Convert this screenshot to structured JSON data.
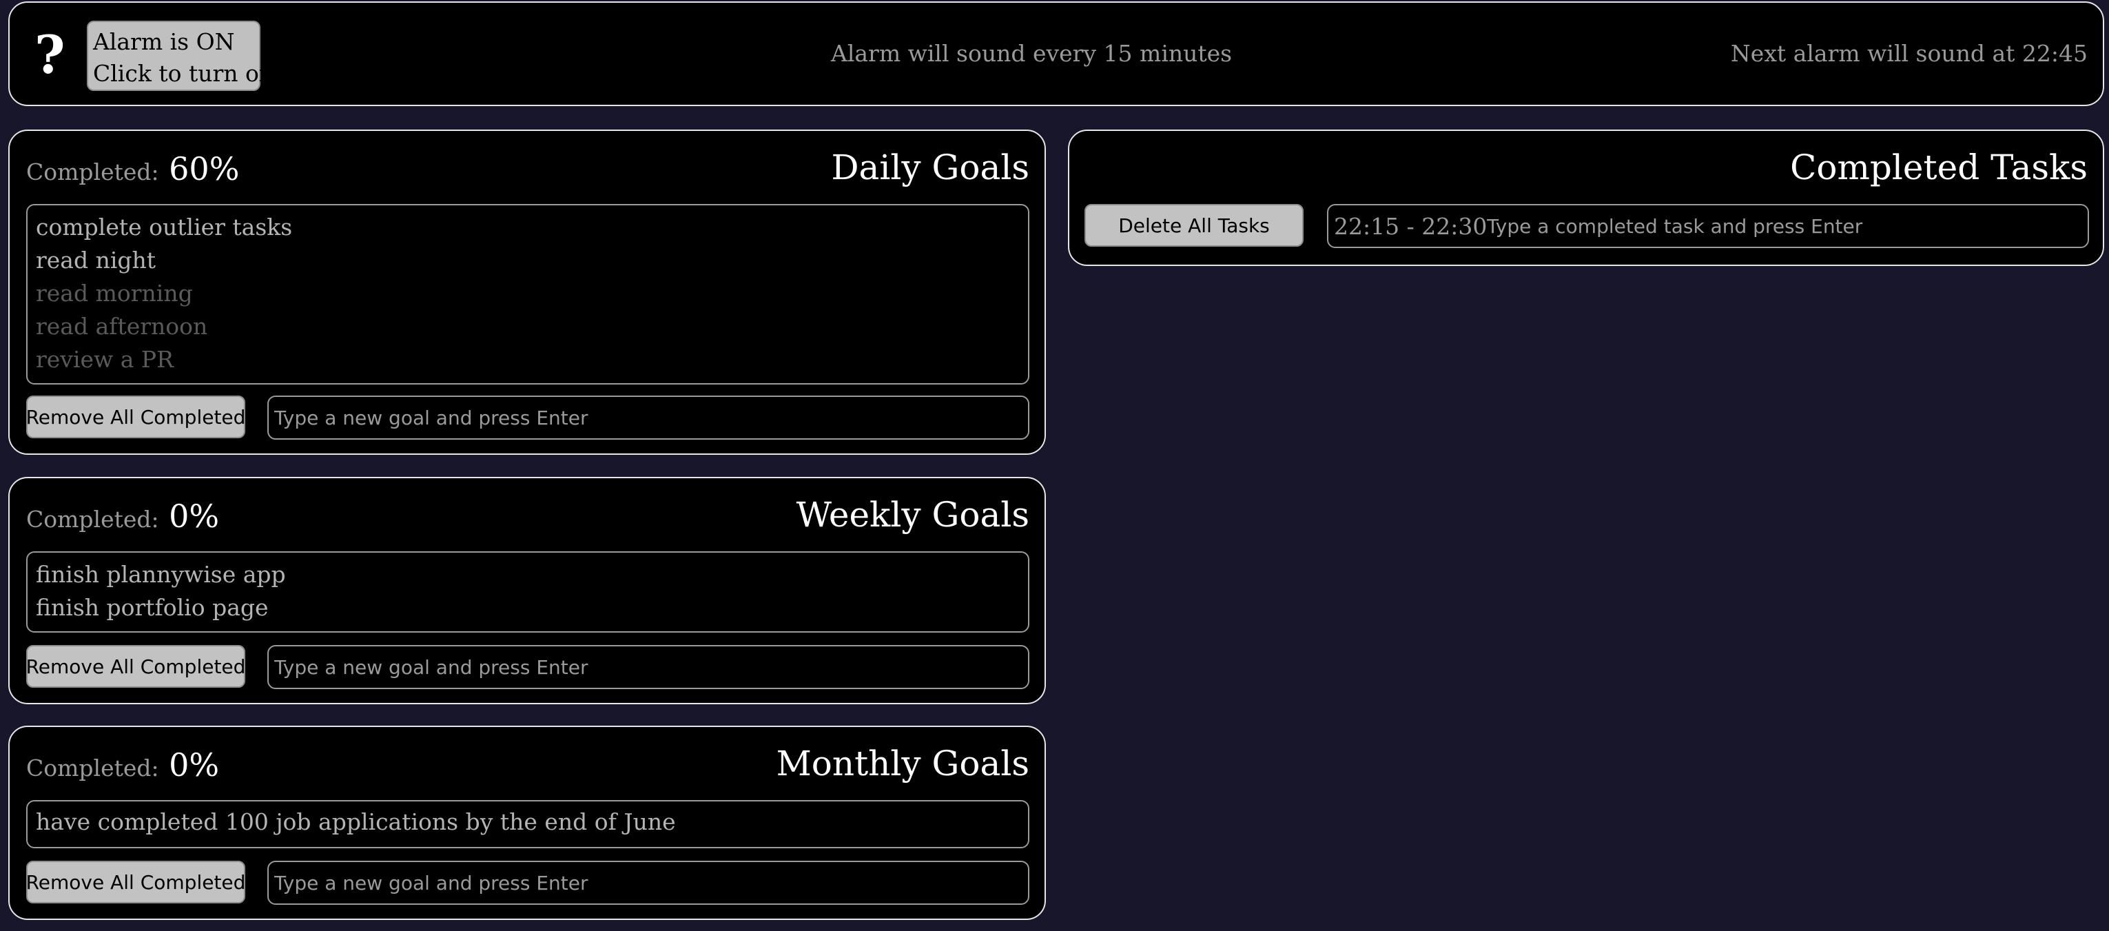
{
  "header": {
    "help_icon": "?",
    "alarm_toggle": {
      "status": "Alarm is ON",
      "action": "Click to turn off"
    },
    "alarm_interval_text": "Alarm will sound every 15 minutes",
    "next_alarm_text": "Next alarm will sound at 22:45"
  },
  "colors": {
    "page_background": "#17162a",
    "panel_background": "#000000",
    "panel_border": "#e6e6e6",
    "button_background": "#c2c2c2",
    "active_goal_text": "#b4b4b4",
    "completed_goal_text": "#5a5a5a"
  },
  "daily": {
    "completed_label": "Completed:",
    "completed_pct": "60%",
    "title": "Daily Goals",
    "goals": [
      {
        "text": "complete outlier tasks",
        "done": false
      },
      {
        "text": "read night",
        "done": false
      },
      {
        "text": "read morning",
        "done": true
      },
      {
        "text": "read afternoon",
        "done": true
      },
      {
        "text": "review a PR",
        "done": true
      }
    ],
    "remove_button": "Remove All Completed",
    "input_placeholder": "Type a new goal and press Enter"
  },
  "weekly": {
    "completed_label": "Completed:",
    "completed_pct": "0%",
    "title": "Weekly Goals",
    "goals": [
      {
        "text": "finish plannywise app",
        "done": false
      },
      {
        "text": "finish portfolio page",
        "done": false
      }
    ],
    "remove_button": "Remove All Completed",
    "input_placeholder": "Type a new goal and press Enter"
  },
  "monthly": {
    "completed_label": "Completed:",
    "completed_pct": "0%",
    "title": "Monthly Goals",
    "goals": [
      {
        "text": "have completed 100 job applications by the end of June",
        "done": false
      }
    ],
    "remove_button": "Remove All Completed",
    "input_placeholder": "Type a new goal and press Enter"
  },
  "completed_tasks": {
    "title": "Completed Tasks",
    "delete_button": "Delete All Tasks",
    "time_range": "22:15 - 22:30",
    "input_placeholder": "Type a completed task and press Enter"
  }
}
